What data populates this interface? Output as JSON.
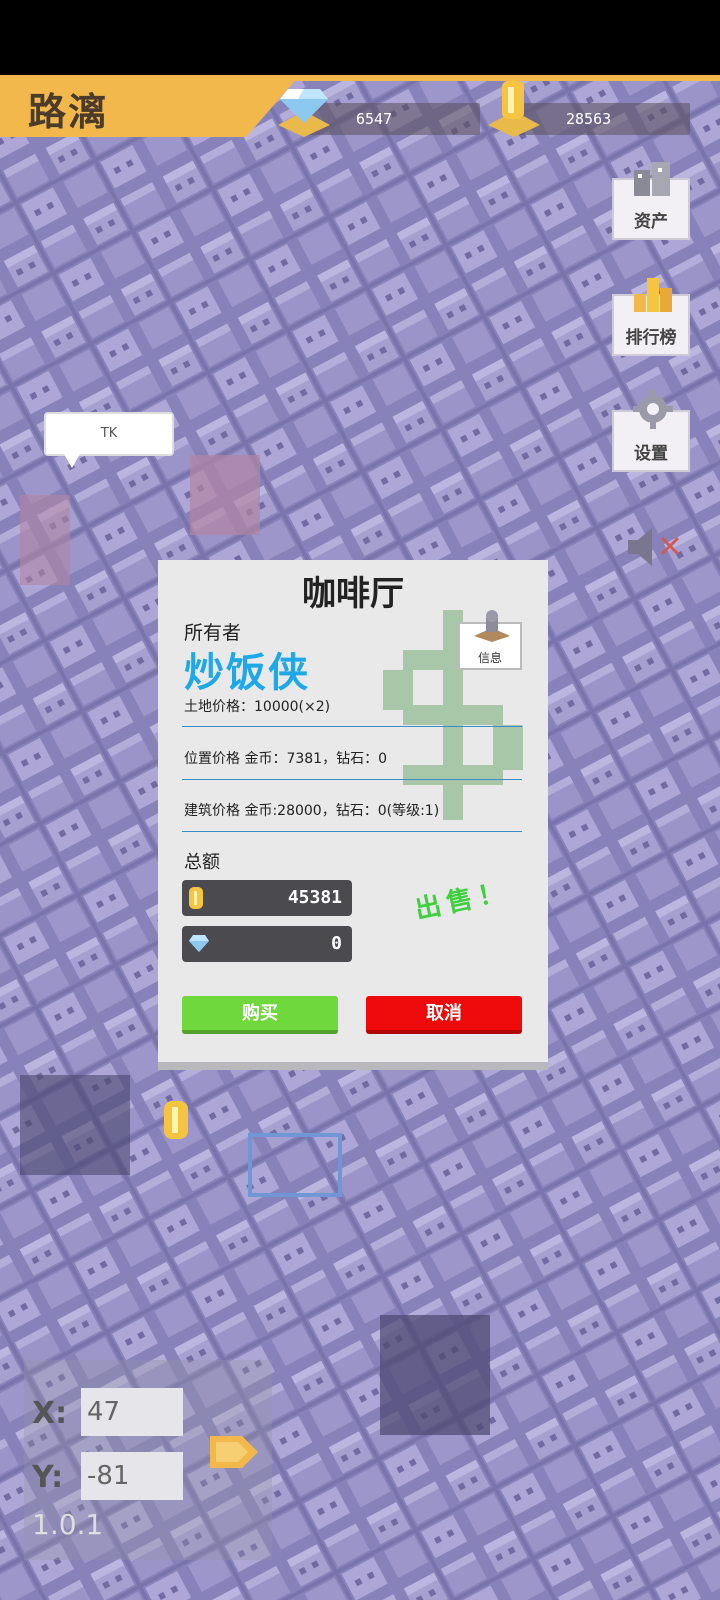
{
  "player": {
    "name": "路漓"
  },
  "resources": {
    "diamonds": "6547",
    "coins": "28563"
  },
  "side_buttons": {
    "assets": "资产",
    "leaderboard": "排行榜",
    "settings": "设置"
  },
  "map_bubble": {
    "text": "TK"
  },
  "dialog": {
    "title": "咖啡厅",
    "owner_label": "所有者",
    "owner_name": "炒饭侠",
    "info_label": "信息",
    "land_price": "土地价格：10000(×2)",
    "location_price": "位置价格 金币：7381，钻石：0",
    "building_price": "建筑价格 金币:28000，钻石：0(等级:1)",
    "total_label": "总额",
    "total_coins": "45381",
    "total_diamonds": "0",
    "sell_label": "出售！",
    "buy_label": "购买",
    "cancel_label": "取消"
  },
  "coords": {
    "x_label": "X:",
    "y_label": "Y:",
    "x_value": "47",
    "y_value": "-81"
  },
  "version": "1.0.1",
  "colors": {
    "banner": "#f2b84b",
    "owner_name": "#1fa8e8",
    "buy": "#6ed83c",
    "cancel": "#ee0a0a",
    "sell": "#3fcf3f"
  }
}
